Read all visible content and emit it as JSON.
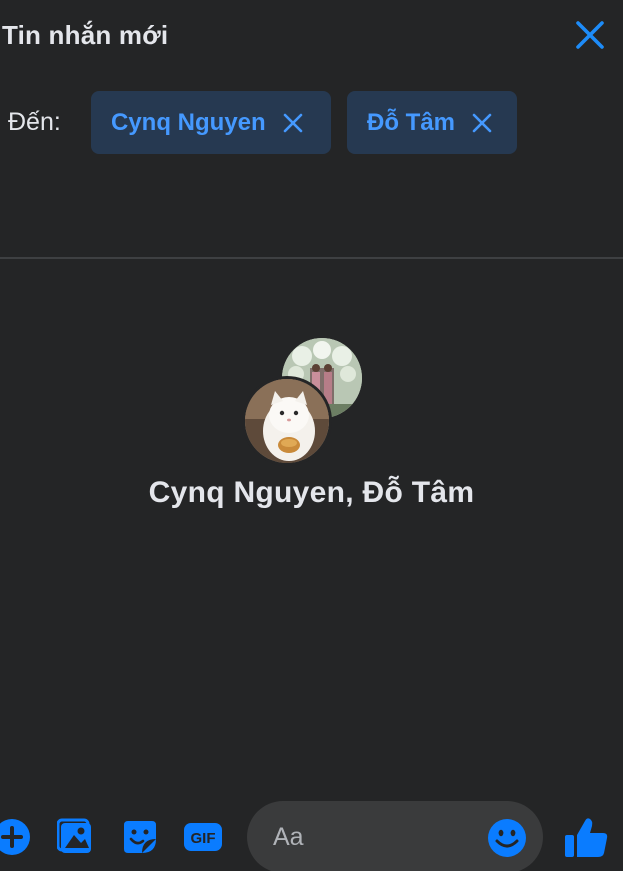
{
  "header": {
    "title": "Tin nhắn mới",
    "close_icon": "close-icon"
  },
  "recipients": {
    "label": "Đến:",
    "chips": [
      {
        "name": "Cynq Nguyen",
        "remove_icon": "close-icon"
      },
      {
        "name": "Đỗ Tâm",
        "remove_icon": "close-icon"
      }
    ]
  },
  "conversation": {
    "group_name": "Cynq Nguyen, Đỗ Tâm",
    "avatars": [
      "avatar-cynq-nguyen",
      "avatar-do-tam"
    ]
  },
  "composer": {
    "placeholder": "Aa",
    "tools": [
      "plus-circle-icon",
      "image-icon",
      "sticker-icon",
      "gif-icon"
    ],
    "gif_label": "GIF",
    "emoji_icon": "emoji-icon",
    "send_icon": "thumbs-up-icon"
  },
  "colors": {
    "background": "#242526",
    "accent": "#0a7cff",
    "chip_bg": "#263951",
    "chip_text": "#4599ff",
    "text": "#e4e6eb",
    "input_bg": "#3a3b3c"
  }
}
